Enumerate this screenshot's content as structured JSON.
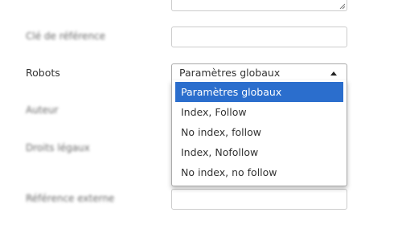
{
  "form": {
    "fields": {
      "meta_keywords_label": "Clé de référence",
      "robots_label": "Robots",
      "author_label": "Auteur",
      "rights_label": "Droits légaux",
      "external_ref_label": "Référence externe"
    },
    "robots_select": {
      "selected": "Paramètres globaux",
      "options": [
        "Paramètres globaux",
        "Index, Follow",
        "No index, follow",
        "Index, Nofollow",
        "No index, no follow"
      ],
      "highlighted_index": 0
    }
  },
  "colors": {
    "highlight": "#2b6ecd",
    "border": "#cccccc",
    "text": "#333333"
  }
}
